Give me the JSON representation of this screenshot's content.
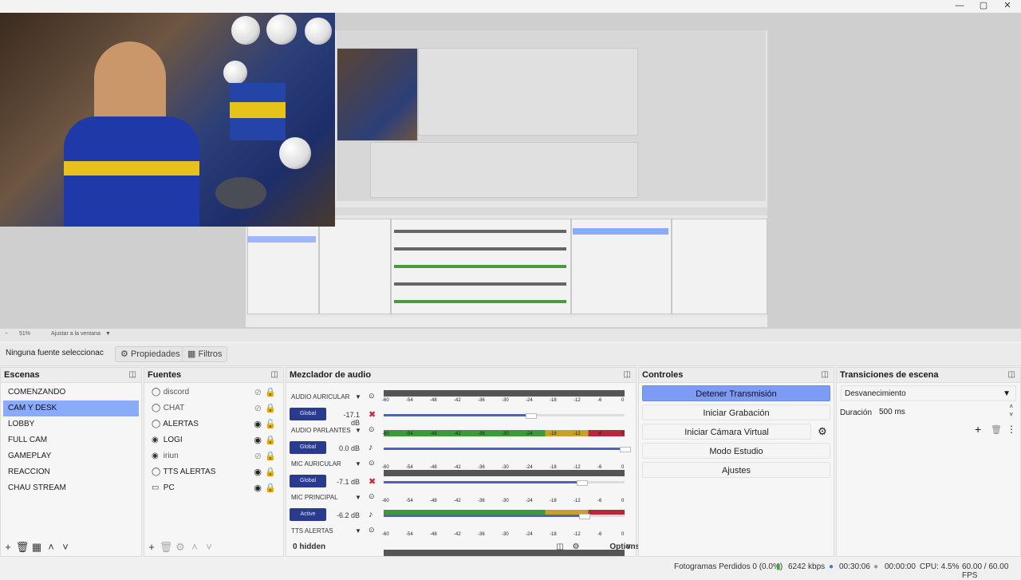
{
  "window": {
    "minimize_icon": "minimize-icon",
    "maximize_icon": "maximize-icon",
    "close_icon": "close-icon"
  },
  "zoom": {
    "level": "51%",
    "fit": "Ajustar a la ventana"
  },
  "source_toolbar": {
    "no_source": "Ninguna fuente seleccionac",
    "properties": "Propiedades",
    "filters": "Filtros"
  },
  "scenes": {
    "title": "Escenas",
    "items": [
      "COMENZANDO",
      "CAM Y DESK",
      "LOBBY",
      "FULL CAM",
      "GAMEPLAY",
      "REACCION",
      "CHAU STREAM"
    ],
    "selected_index": 1
  },
  "sources": {
    "title": "Fuentes",
    "items": [
      {
        "name": "discord",
        "icon": "browser-icon",
        "visible": false
      },
      {
        "name": "CHAT",
        "icon": "browser-icon",
        "visible": false
      },
      {
        "name": "ALERTAS",
        "icon": "browser-icon",
        "visible": true
      },
      {
        "name": "LOGI",
        "icon": "camera-icon",
        "visible": true
      },
      {
        "name": "iriun",
        "icon": "camera-icon",
        "visible": false
      },
      {
        "name": "TTS ALERTAS",
        "icon": "browser-icon",
        "visible": true
      },
      {
        "name": "PC",
        "icon": "monitor-icon",
        "visible": true
      }
    ]
  },
  "mixer": {
    "title": "Mezclador de audio",
    "hidden": "0 hidden",
    "options": "Options",
    "ticks": [
      "-60",
      "-54",
      "-48",
      "-42",
      "-36",
      "-30",
      "-24",
      "-18",
      "-12",
      "-6",
      "0"
    ],
    "channels": [
      {
        "name": "AUDIO AURICULAR",
        "button": "Global",
        "db": "-17.1 dB",
        "muted": true,
        "level": 0.61
      },
      {
        "name": "AUDIO PARLANTES",
        "button": "Global",
        "db": "0.0 dB",
        "muted": false,
        "level": 1.0
      },
      {
        "name": "MIC AURICULAR",
        "button": "Global",
        "db": "-7.1 dB",
        "muted": true,
        "level": 0.82
      },
      {
        "name": "MIC PRINCIPAL",
        "button": "Active",
        "db": "-6.2 dB",
        "muted": false,
        "level": 0.83
      },
      {
        "name": "TTS ALERTAS",
        "button": "",
        "db": "",
        "muted": false,
        "level": 0
      }
    ]
  },
  "controls": {
    "title": "Controles",
    "stop_stream": "Detener Transmisión",
    "start_record": "Iniciar Grabación",
    "virtual_cam": "Iniciar Cámara Virtual",
    "studio_mode": "Modo Estudio",
    "settings": "Ajustes"
  },
  "transitions": {
    "title": "Transiciones de escena",
    "selected": "Desvanecimiento",
    "duration_label": "Duración",
    "duration_value": "500 ms"
  },
  "status": {
    "dropped": "Fotogramas Perdidos 0 (0.0%)",
    "bitrate": "6242 kbps",
    "stream_time": "00:30:06",
    "record_time": "00:00:00",
    "cpu": "CPU: 4.5%",
    "fps": "60.00 / 60.00 FPS"
  },
  "colors": {
    "accent": "#8aaafa",
    "global_btn": "#2a3a8f",
    "slider": "#4a63c8"
  }
}
